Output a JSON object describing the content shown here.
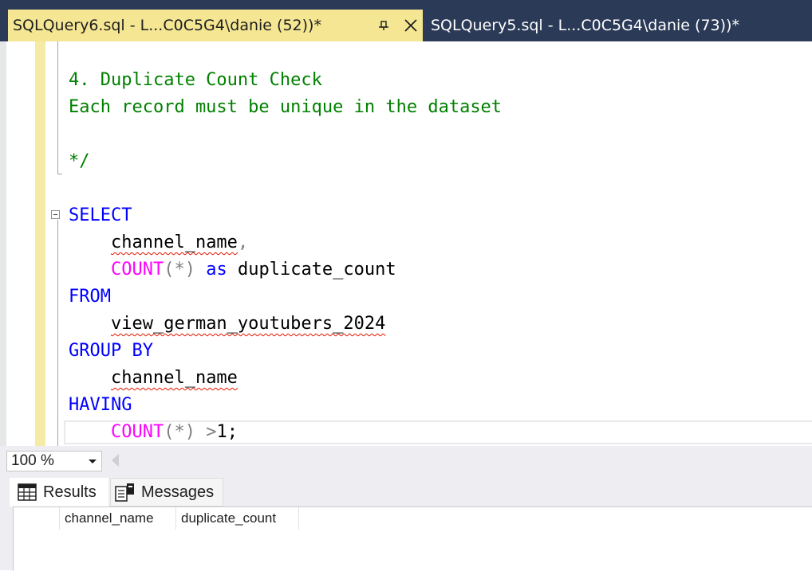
{
  "tabs": {
    "active": {
      "title": "SQLQuery6.sql - L...C0C5G4\\danie (52))*",
      "pin_icon": "pin-icon",
      "close_icon": "close-icon"
    },
    "inactive": {
      "title": "SQLQuery5.sql - L...C0C5G4\\danie (73))*"
    }
  },
  "editor": {
    "comment_heading": "4. Duplicate Count Check",
    "comment_body": "Each record must be unique in the dataset",
    "comment_end": "*/",
    "kw_select": "SELECT",
    "col_channel_name": "channel_name",
    "comma": ",",
    "fn_count": "COUNT",
    "paren_open": "(",
    "star": "*",
    "paren_close": ")",
    "kw_as": "as",
    "alias": "duplicate_count",
    "kw_from": "FROM",
    "table_name": "view_german_youtubers_2024",
    "kw_group_by": "GROUP BY",
    "group_col": "channel_name",
    "kw_having": "HAVING",
    "gt": ">",
    "one": "1",
    "semicolon": ";"
  },
  "zoom": {
    "value": "100 %"
  },
  "results": {
    "tab_results": "Results",
    "tab_messages": "Messages",
    "columns": [
      "channel_name",
      "duplicate_count"
    ]
  },
  "colors": {
    "keyword": "#0000ff",
    "function": "#ff00ff",
    "comment": "#008000",
    "active_tab": "#f4e693",
    "tab_strip": "#2b3a57"
  }
}
